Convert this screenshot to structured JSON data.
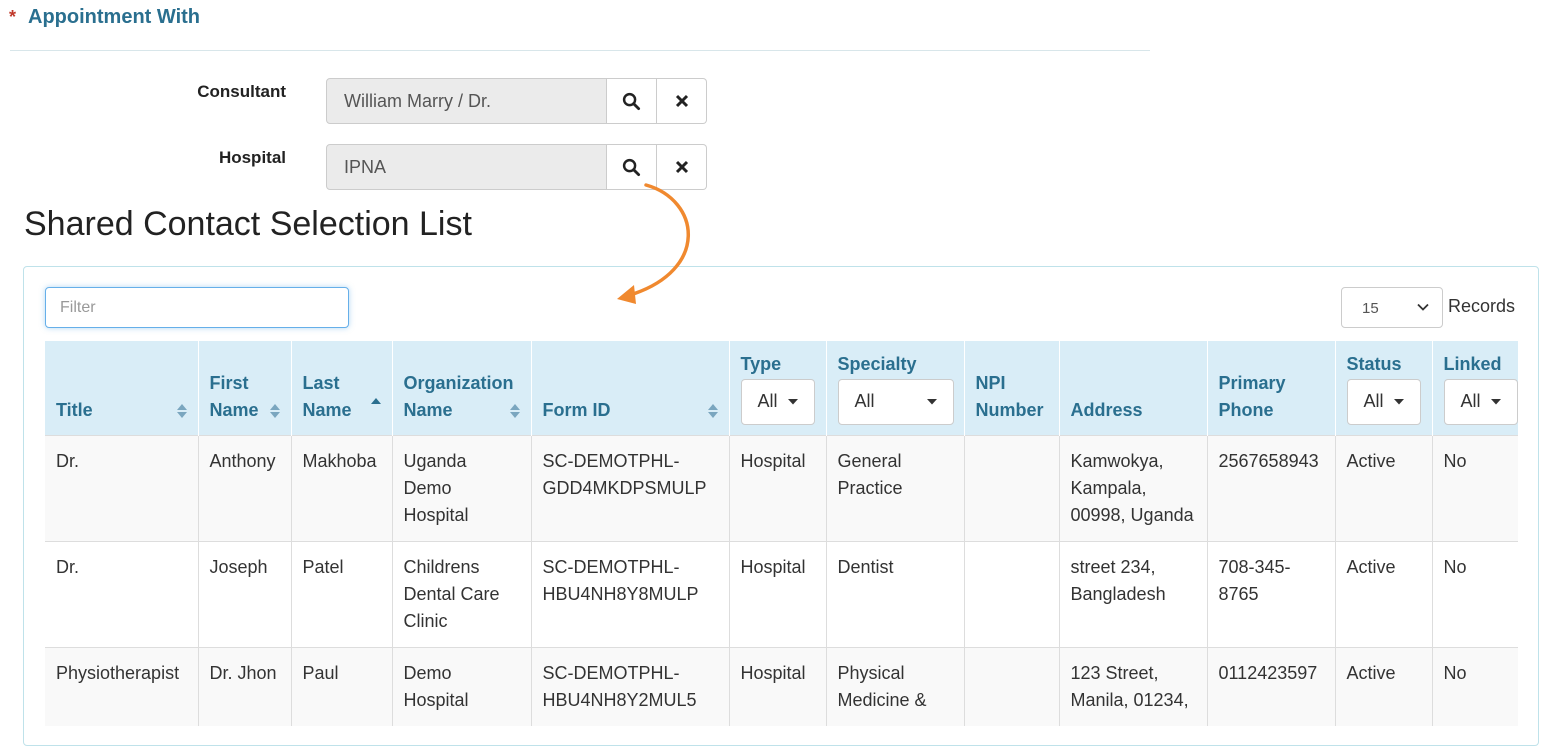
{
  "section": {
    "required_mark": "*",
    "title": "Appointment With"
  },
  "consultant": {
    "label": "Consultant",
    "value": "William Marry / Dr."
  },
  "hospital": {
    "label": "Hospital",
    "value": "IPNA"
  },
  "icons": {
    "search": "search-icon",
    "clear": "close-icon",
    "sort": "sort-icon",
    "dropdown": "caret-down-icon"
  },
  "list": {
    "title": "Shared Contact Selection List",
    "filter_placeholder": "Filter",
    "records_value": "15",
    "records_label": "Records"
  },
  "table": {
    "headers": {
      "title": "Title",
      "first_name": "First Name",
      "last_name": "Last Name",
      "organization_name": "Organization Name",
      "form_id": "Form ID",
      "type": "Type",
      "type_filter": "All",
      "specialty": "Specialty",
      "specialty_filter": "All",
      "npi_number": "NPI Number",
      "address": "Address",
      "primary_phone": "Primary Phone",
      "status": "Status",
      "status_filter": "All",
      "linked": "Linked",
      "linked_filter": "All"
    },
    "rows": [
      {
        "title": "Dr.",
        "first_name": "Anthony",
        "last_name": "Makhoba",
        "organization_name": "Uganda Demo Hospital",
        "form_id": "SC-DEMOTPHL-GDD4MKDPSMULP",
        "type": "Hospital",
        "specialty": "General Practice",
        "npi_number": "",
        "address": "Kamwokya, Kampala, 00998, Uganda",
        "primary_phone": "2567658943",
        "status": "Active",
        "linked": "No"
      },
      {
        "title": "Dr.",
        "first_name": "Joseph",
        "last_name": "Patel",
        "organization_name": "Childrens Dental Care Clinic",
        "form_id": "SC-DEMOTPHL-HBU4NH8Y8MULP",
        "type": "Hospital",
        "specialty": "Dentist",
        "npi_number": "",
        "address": "street 234, Bangladesh",
        "primary_phone": "708-345-8765",
        "status": "Active",
        "linked": "No"
      },
      {
        "title": "Physiotherapist",
        "first_name": "Dr. Jhon",
        "last_name": "Paul",
        "organization_name": "Demo Hospital",
        "form_id": "SC-DEMOTPHL-HBU4NH8Y2MUL5",
        "type": "Hospital",
        "specialty": "Physical Medicine &",
        "npi_number": "",
        "address": "123 Street, Manila, 01234,",
        "primary_phone": "0112423597",
        "status": "Active",
        "linked": "No"
      }
    ]
  },
  "colors": {
    "accent": "#2a6f8f",
    "header_bg": "#d9edf7",
    "arrow": "#f0892f",
    "required": "#c0392b"
  }
}
